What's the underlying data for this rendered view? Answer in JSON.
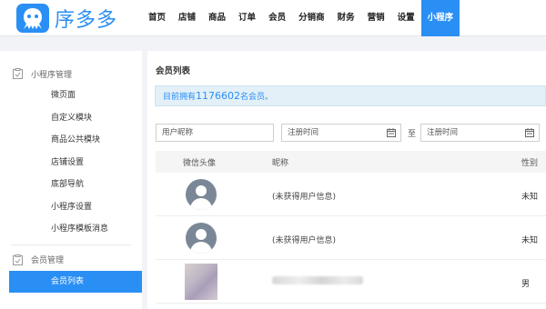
{
  "header": {
    "logo_text": "序多多",
    "nav": [
      "首页",
      "店铺",
      "商品",
      "订单",
      "会员",
      "分销商",
      "财务",
      "营销",
      "设置",
      "小程序"
    ],
    "active_nav": "小程序"
  },
  "sidebar": {
    "groups": [
      {
        "title": "小程序管理",
        "items": [
          "微页面",
          "自定义模块",
          "商品公共模块",
          "店铺设置",
          "底部导航",
          "小程序设置",
          "小程序模板消息"
        ]
      },
      {
        "title": "会员管理",
        "items": [
          "会员列表"
        ]
      }
    ],
    "active_item": "会员列表"
  },
  "main": {
    "title": "会员列表",
    "notice_prefix": "目前拥有",
    "member_count": "1176602",
    "notice_suffix": "名会员。",
    "filters": {
      "nickname_placeholder": "用户昵称",
      "reg_from_placeholder": "注册时间",
      "to_label": "至",
      "reg_to_placeholder": "注册时间"
    },
    "columns": [
      "微信头像",
      "昵称",
      "性别"
    ],
    "rows": [
      {
        "nickname": "(未获得用户信息)",
        "gender": "未知"
      },
      {
        "nickname": "(未获得用户信息)",
        "gender": "未知"
      },
      {
        "nickname": "",
        "gender": "男"
      }
    ]
  },
  "colors": {
    "accent": "#2a8ff4",
    "notice_bg": "#e3f0f8"
  }
}
